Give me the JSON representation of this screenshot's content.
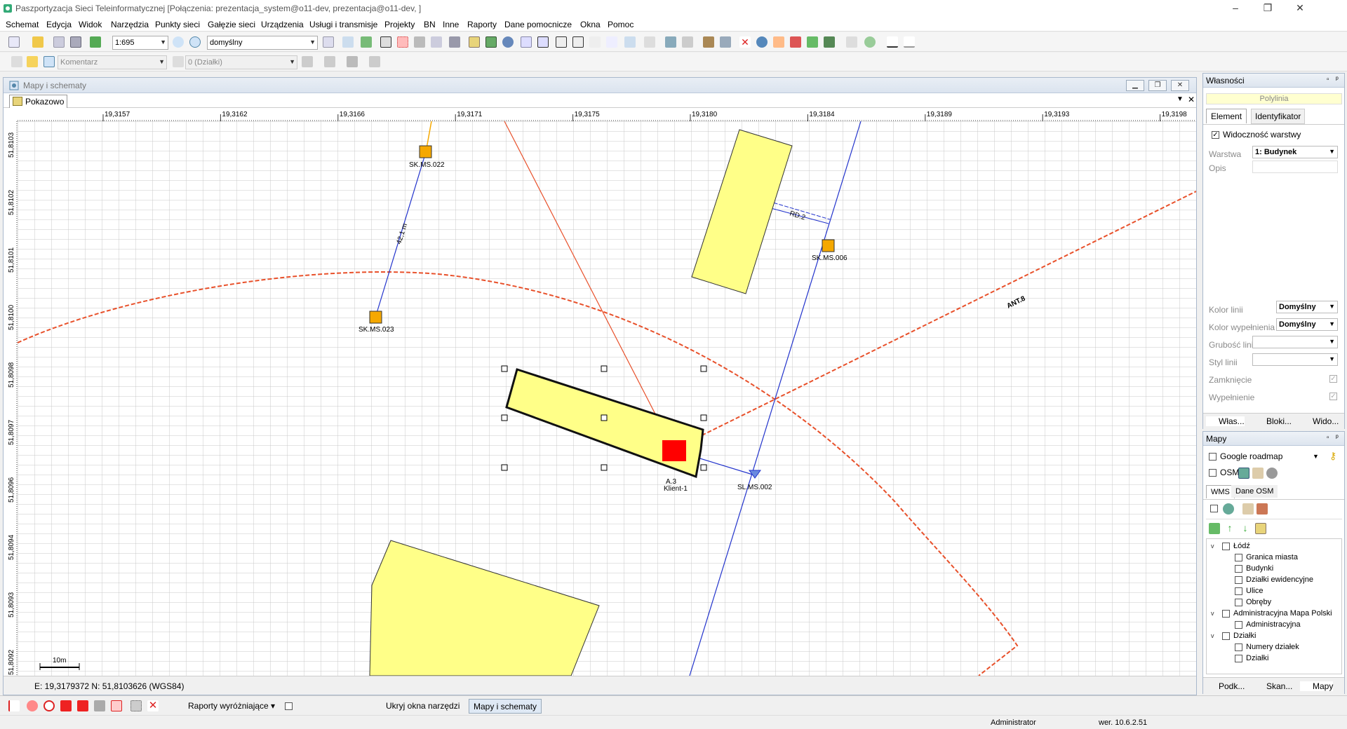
{
  "window": {
    "title": "Paszportyzacja Sieci Teleinformatycznej [Połączenia: prezentacja_system@o11-dev, prezentacja@o11-dev, ]",
    "minimize": "–",
    "maximize": "❐",
    "close": "✕"
  },
  "menu": [
    "Schemat",
    "Edycja",
    "Widok",
    "Narzędzia",
    "Punkty sieci",
    "Gałęzie sieci",
    "Urządzenia",
    "Usługi i transmisje",
    "Projekty",
    "BN",
    "Inne",
    "Raporty",
    "Dane pomocnicze",
    "Okna",
    "Pomoc"
  ],
  "toolbar": {
    "scale": "1:695",
    "view": "domyślny",
    "comment": "Komentarz",
    "layer": "0 (Działki)"
  },
  "map_window": {
    "title": "Mapy i schematy",
    "tab": "Pokazowo",
    "coords": "E: 19,3179372  N: 51,8103626 (WGS84)",
    "scalebar": "10m",
    "x_ticks": [
      "19,3157",
      "19,3162",
      "19,3166",
      "19,3171",
      "19,3175",
      "19,3180",
      "19,3184",
      "19,3189",
      "19,3193",
      "19,3198"
    ],
    "y_ticks": [
      "51,8103",
      "51,8102",
      "51,8101",
      "51,8100",
      "51,8098",
      "51,8097",
      "51,8096",
      "51,8094",
      "51,8093",
      "51,8092"
    ],
    "labels": {
      "sk022": "SK.MS.022",
      "sk023": "SK.MS.023",
      "sk006": "SK.MS.006",
      "sl002": "SL.MS.002",
      "klient": "Klient-1",
      "a_prefix": "A.3",
      "dist": "42,1 m",
      "rd": "RD.2",
      "ant": "ANT.8"
    }
  },
  "properties": {
    "title": "Własności",
    "type": "Polylinia",
    "tabs": [
      "Element",
      "Identyfikator"
    ],
    "visibility": "Widoczność warstwy",
    "fields": {
      "warstwa_label": "Warstwa",
      "warstwa_value": "1: Budynek",
      "opis_label": "Opis",
      "kolor_linii_label": "Kolor linii",
      "kolor_linii_value": "Domyślny",
      "kolor_wyp_label": "Kolor wypełnienia",
      "kolor_wyp_value": "Domyślny",
      "grubosc_label": "Grubość linii",
      "styl_label": "Styl linii",
      "zamkniecie_label": "Zamknięcie",
      "wypelnienie_label": "Wypełnienie"
    },
    "bottom_tabs": [
      "Włas...",
      "Bloki...",
      "Wido..."
    ]
  },
  "maps_panel": {
    "title": "Mapy",
    "google": "Google roadmap",
    "osm": "OSM",
    "tabs": [
      "WMS",
      "Dane OSM"
    ],
    "tree": [
      {
        "label": "Łódź",
        "level": 0,
        "expanded": true
      },
      {
        "label": "Granica miasta",
        "level": 1
      },
      {
        "label": "Budynki",
        "level": 1
      },
      {
        "label": "Działki ewidencyjne",
        "level": 1
      },
      {
        "label": "Ulice",
        "level": 1
      },
      {
        "label": "Obręby",
        "level": 1
      },
      {
        "label": "Administracyjna Mapa Polski",
        "level": 0,
        "expanded": true
      },
      {
        "label": "Administracyjna",
        "level": 1
      },
      {
        "label": "Działki",
        "level": 0,
        "expanded": true
      },
      {
        "label": "Numery działek",
        "level": 1
      },
      {
        "label": "Działki",
        "level": 1
      }
    ],
    "bottom_tabs": [
      "Podk...",
      "Skan...",
      "Mapy"
    ]
  },
  "bottom": {
    "raporty": "Raporty wyróżniające",
    "ukryj": "Ukryj okna narzędzi",
    "mapy": "Mapy i schematy"
  },
  "statusbar": {
    "user": "Administrator",
    "version": "wer. 10.6.2.51"
  },
  "colors": {
    "building_fill": "#ffff88",
    "route_blue": "#2233cc",
    "route_red": "#e8502a",
    "node_orange": "#f5a800",
    "selection_red": "#ff0000"
  }
}
